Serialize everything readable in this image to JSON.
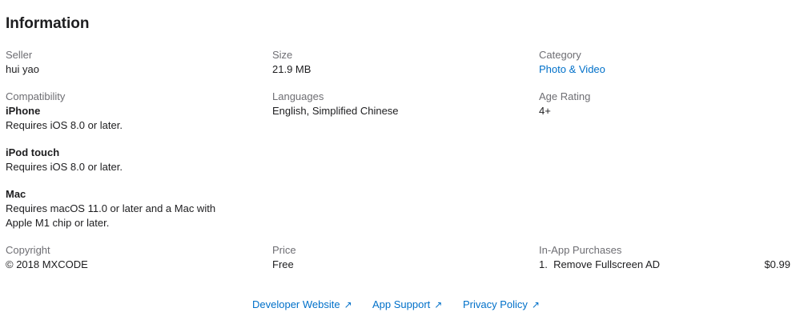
{
  "section_title": "Information",
  "seller": {
    "label": "Seller",
    "value": "hui yao"
  },
  "size": {
    "label": "Size",
    "value": "21.9 MB"
  },
  "category": {
    "label": "Category",
    "value": "Photo & Video"
  },
  "compatibility": {
    "label": "Compatibility",
    "devices": [
      {
        "name": "iPhone",
        "requirement": "Requires iOS 8.0 or later."
      },
      {
        "name": "iPod touch",
        "requirement": "Requires iOS 8.0 or later."
      },
      {
        "name": "Mac",
        "requirement_line1": "Requires macOS 11.0 or later and a Mac with",
        "requirement_line2": "Apple M1 chip or later."
      }
    ]
  },
  "languages": {
    "label": "Languages",
    "value": "English, Simplified Chinese"
  },
  "age_rating": {
    "label": "Age Rating",
    "value": "4+"
  },
  "copyright": {
    "label": "Copyright",
    "value": "© 2018 MXCODE"
  },
  "price": {
    "label": "Price",
    "value": "Free"
  },
  "in_app_purchases": {
    "label": "In-App Purchases",
    "items": [
      {
        "name": "1.  Remove Fullscreen AD",
        "price": "$0.99"
      }
    ]
  },
  "footer_links": {
    "developer_website": "Developer Website",
    "app_support": "App Support",
    "privacy_policy": "Privacy Policy",
    "arrow_icon": "↗"
  },
  "colors": {
    "link": "#0070c9",
    "label": "#6e6e73",
    "text": "#1d1d1f"
  }
}
